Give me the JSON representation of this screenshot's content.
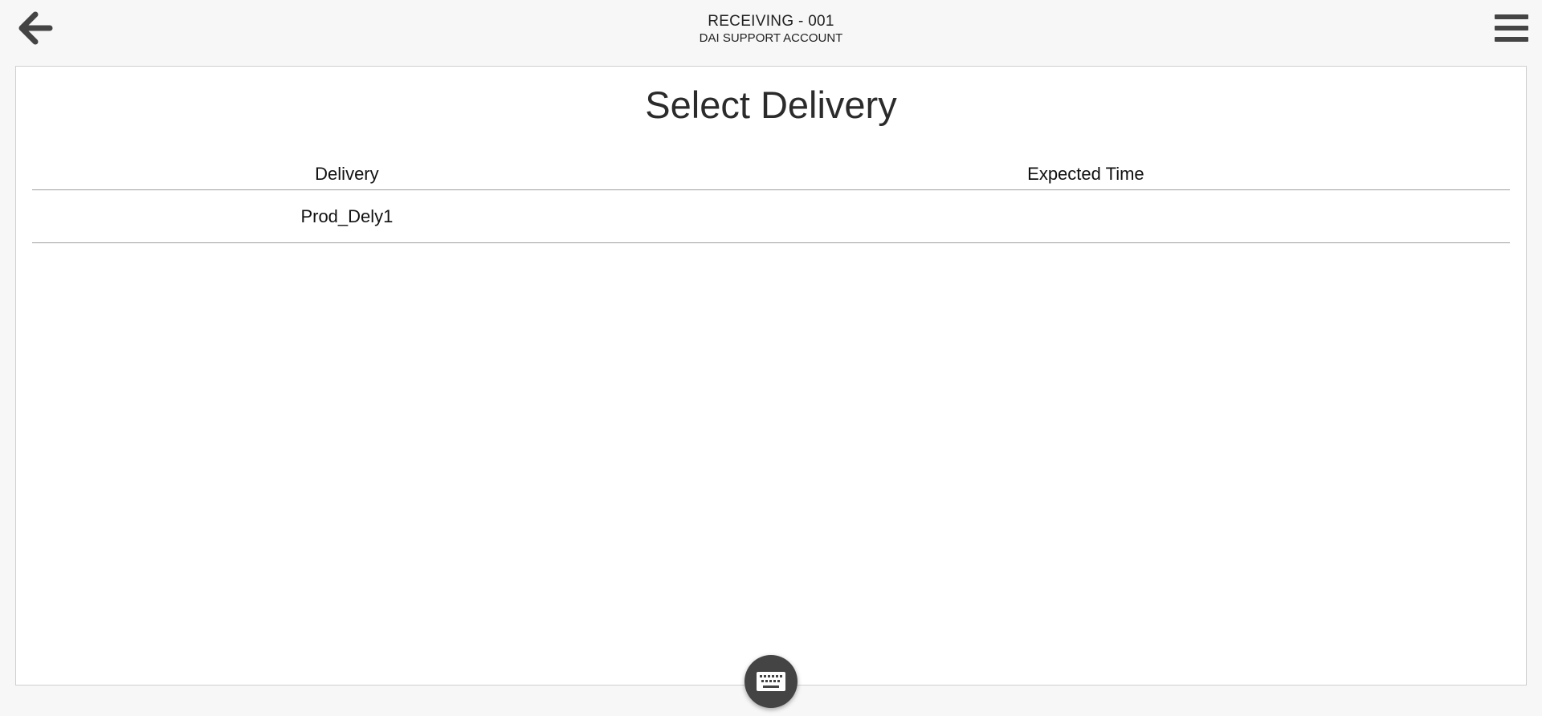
{
  "header": {
    "title": "RECEIVING - 001",
    "subtitle": "DAI SUPPORT ACCOUNT",
    "back_icon": "arrow-left-icon",
    "menu_icon": "hamburger-menu-icon"
  },
  "main": {
    "title": "Select Delivery",
    "table": {
      "columns": [
        "Delivery",
        "Expected Time"
      ],
      "rows": [
        {
          "delivery": "Prod_Dely1",
          "expected_time": ""
        }
      ]
    }
  },
  "fab": {
    "icon": "keyboard-icon"
  },
  "colors": {
    "background": "#f7f7f7",
    "panel": "#ffffff",
    "icon": "#444444"
  }
}
